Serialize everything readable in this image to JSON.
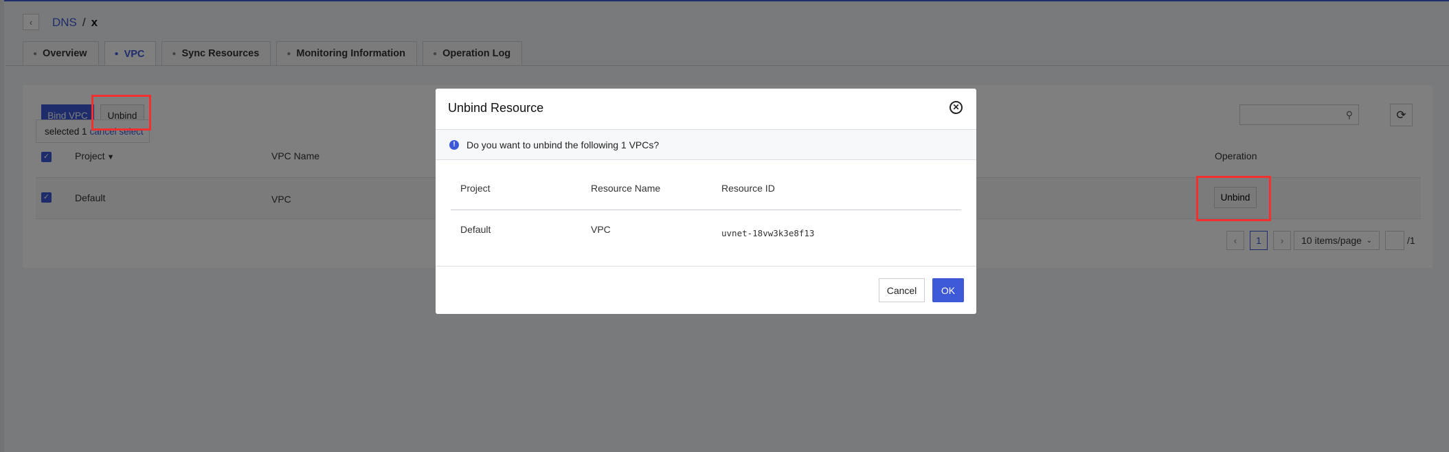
{
  "breadcrumb": {
    "parent": "DNS",
    "separator": "/",
    "current": "x"
  },
  "tabs": [
    {
      "label": "Overview"
    },
    {
      "label": "VPC"
    },
    {
      "label": "Sync Resources"
    },
    {
      "label": "Monitoring Information"
    },
    {
      "label": "Operation Log"
    }
  ],
  "toolbar": {
    "bind_label": "Bind VPC",
    "unbind_label": "Unbind"
  },
  "selection": {
    "prefix": "selected 1",
    "cancel_label": "cancel select"
  },
  "table": {
    "headers": {
      "project": "Project",
      "vpc_name": "VPC Name",
      "operation": "Operation"
    },
    "rows": [
      {
        "project": "Default",
        "vpc_name": "VPC",
        "action": "Unbind"
      }
    ]
  },
  "pagination": {
    "current": "1",
    "page_size": "10 items/page",
    "total": "/1"
  },
  "dialog": {
    "title": "Unbind Resource",
    "message": "Do you want to unbind the following 1 VPCs?",
    "headers": {
      "project": "Project",
      "resource_name": "Resource Name",
      "resource_id": "Resource ID"
    },
    "rows": [
      {
        "project": "Default",
        "resource_name": "VPC",
        "resource_id": "uvnet-18vw3k3e8f13"
      }
    ],
    "cancel_label": "Cancel",
    "ok_label": "OK"
  },
  "colors": {
    "accent": "#3d59d8",
    "highlight": "#f2302f"
  }
}
